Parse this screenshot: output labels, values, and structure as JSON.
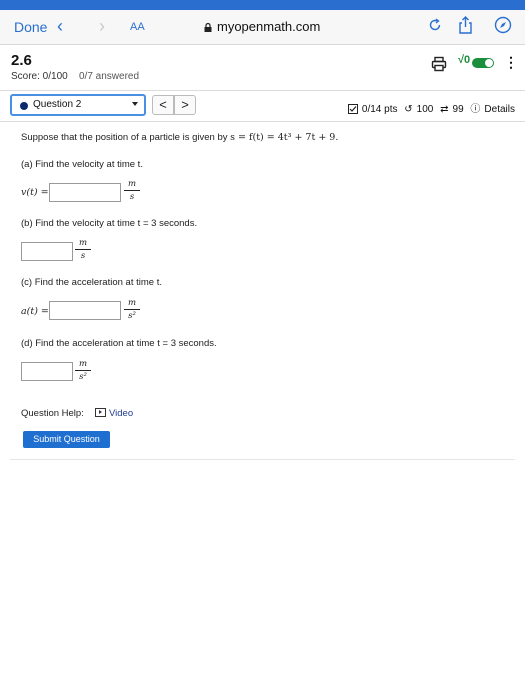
{
  "browser": {
    "done_label": "Done",
    "text_size_label": "AA",
    "url": "myopenmath.com"
  },
  "header": {
    "title": "2.6",
    "score": "Score: 0/100",
    "answered": "0/7 answered"
  },
  "question_bar": {
    "selected_question": "Question 2",
    "prev_label": "<",
    "next_label": ">",
    "points": "0/14 pts",
    "retries": "100",
    "regens": "99",
    "details_label": "Details"
  },
  "question": {
    "intro_prefix": "Suppose that the position of a particle is given by",
    "intro_equation": "s = f(t) = 4t³ + 7t + 9.",
    "part_a": "(a) Find the velocity at time t.",
    "part_a_prefix": "v(t) =",
    "part_b": "(b) Find the velocity at time t = 3 seconds.",
    "part_c": "(c) Find the acceleration at time t.",
    "part_c_prefix": "a(t) =",
    "part_d": "(d) Find the acceleration at time t = 3 seconds.",
    "unit_m": "m",
    "unit_s": "s",
    "unit_s2": "s²"
  },
  "footer": {
    "help_label": "Question Help:",
    "video_label": "Video",
    "submit_label": "Submit Question"
  }
}
